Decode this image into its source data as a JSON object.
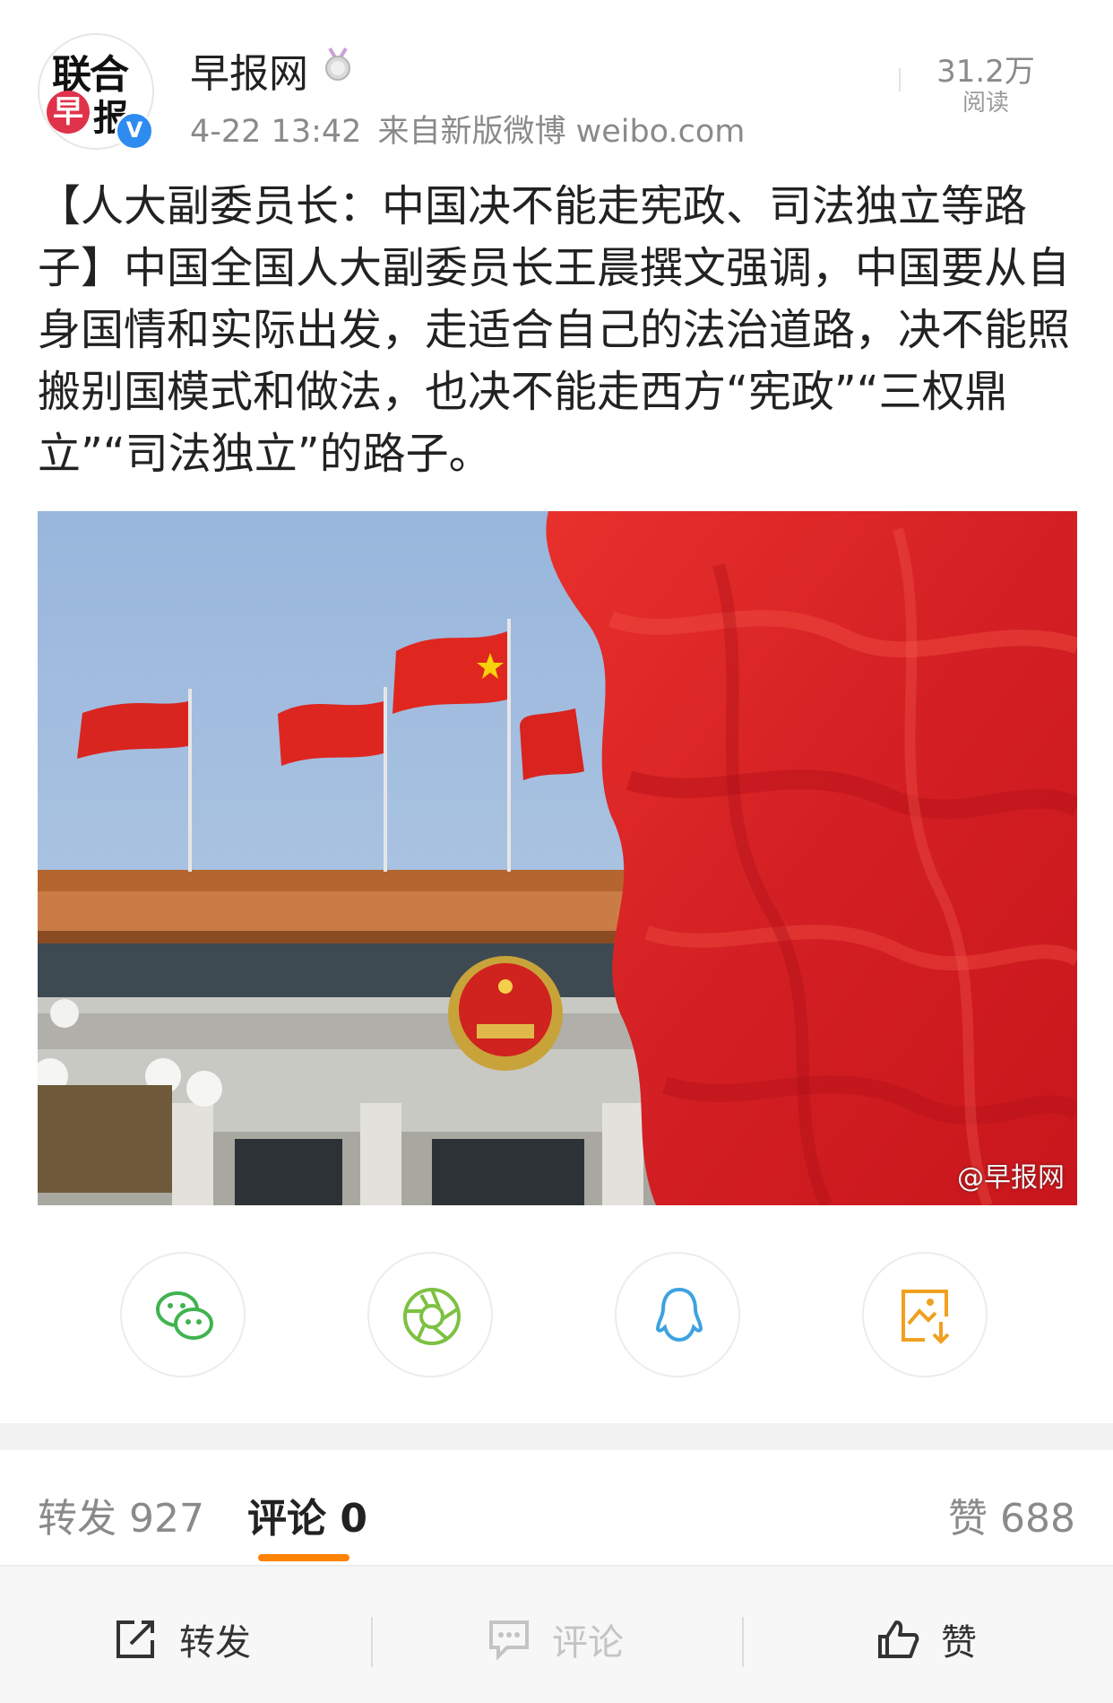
{
  "account": {
    "name": "早报网",
    "avatar_text_1": "联合",
    "avatar_text_2": "早",
    "avatar_text_3": "报",
    "verified_badge": "V",
    "time": "4-22 13:42",
    "source": "来自新版微博 weibo.com"
  },
  "reads": {
    "count": "31.2万",
    "label": "阅读"
  },
  "post": {
    "text": "【人大副委员长：中国决不能走宪政、司法独立等路子】中国全国人大副委员长王晨撰文强调，中国要从自身国情和实际出发，走适合自己的法治道路，决不能照搬别国模式和做法，也决不能走西方“宪政”“三权鼎立”“司法独立”的路子。"
  },
  "image": {
    "watermark": "@早报网"
  },
  "share": [
    {
      "icon": "wechat-icon",
      "color": "#3fb34f"
    },
    {
      "icon": "moments-icon",
      "color": "#7dc142"
    },
    {
      "icon": "qq-icon",
      "color": "#3ea2e0"
    },
    {
      "icon": "save-image-icon",
      "color": "#f0a020"
    }
  ],
  "tabs": {
    "repost": "转发 927",
    "comments": "评论 0",
    "likes": "赞 688"
  },
  "actions": {
    "repost": "转发",
    "comment": "评论",
    "like": "赞"
  },
  "colors": {
    "accent": "#ff8200",
    "verified": "#2e8cf0"
  }
}
